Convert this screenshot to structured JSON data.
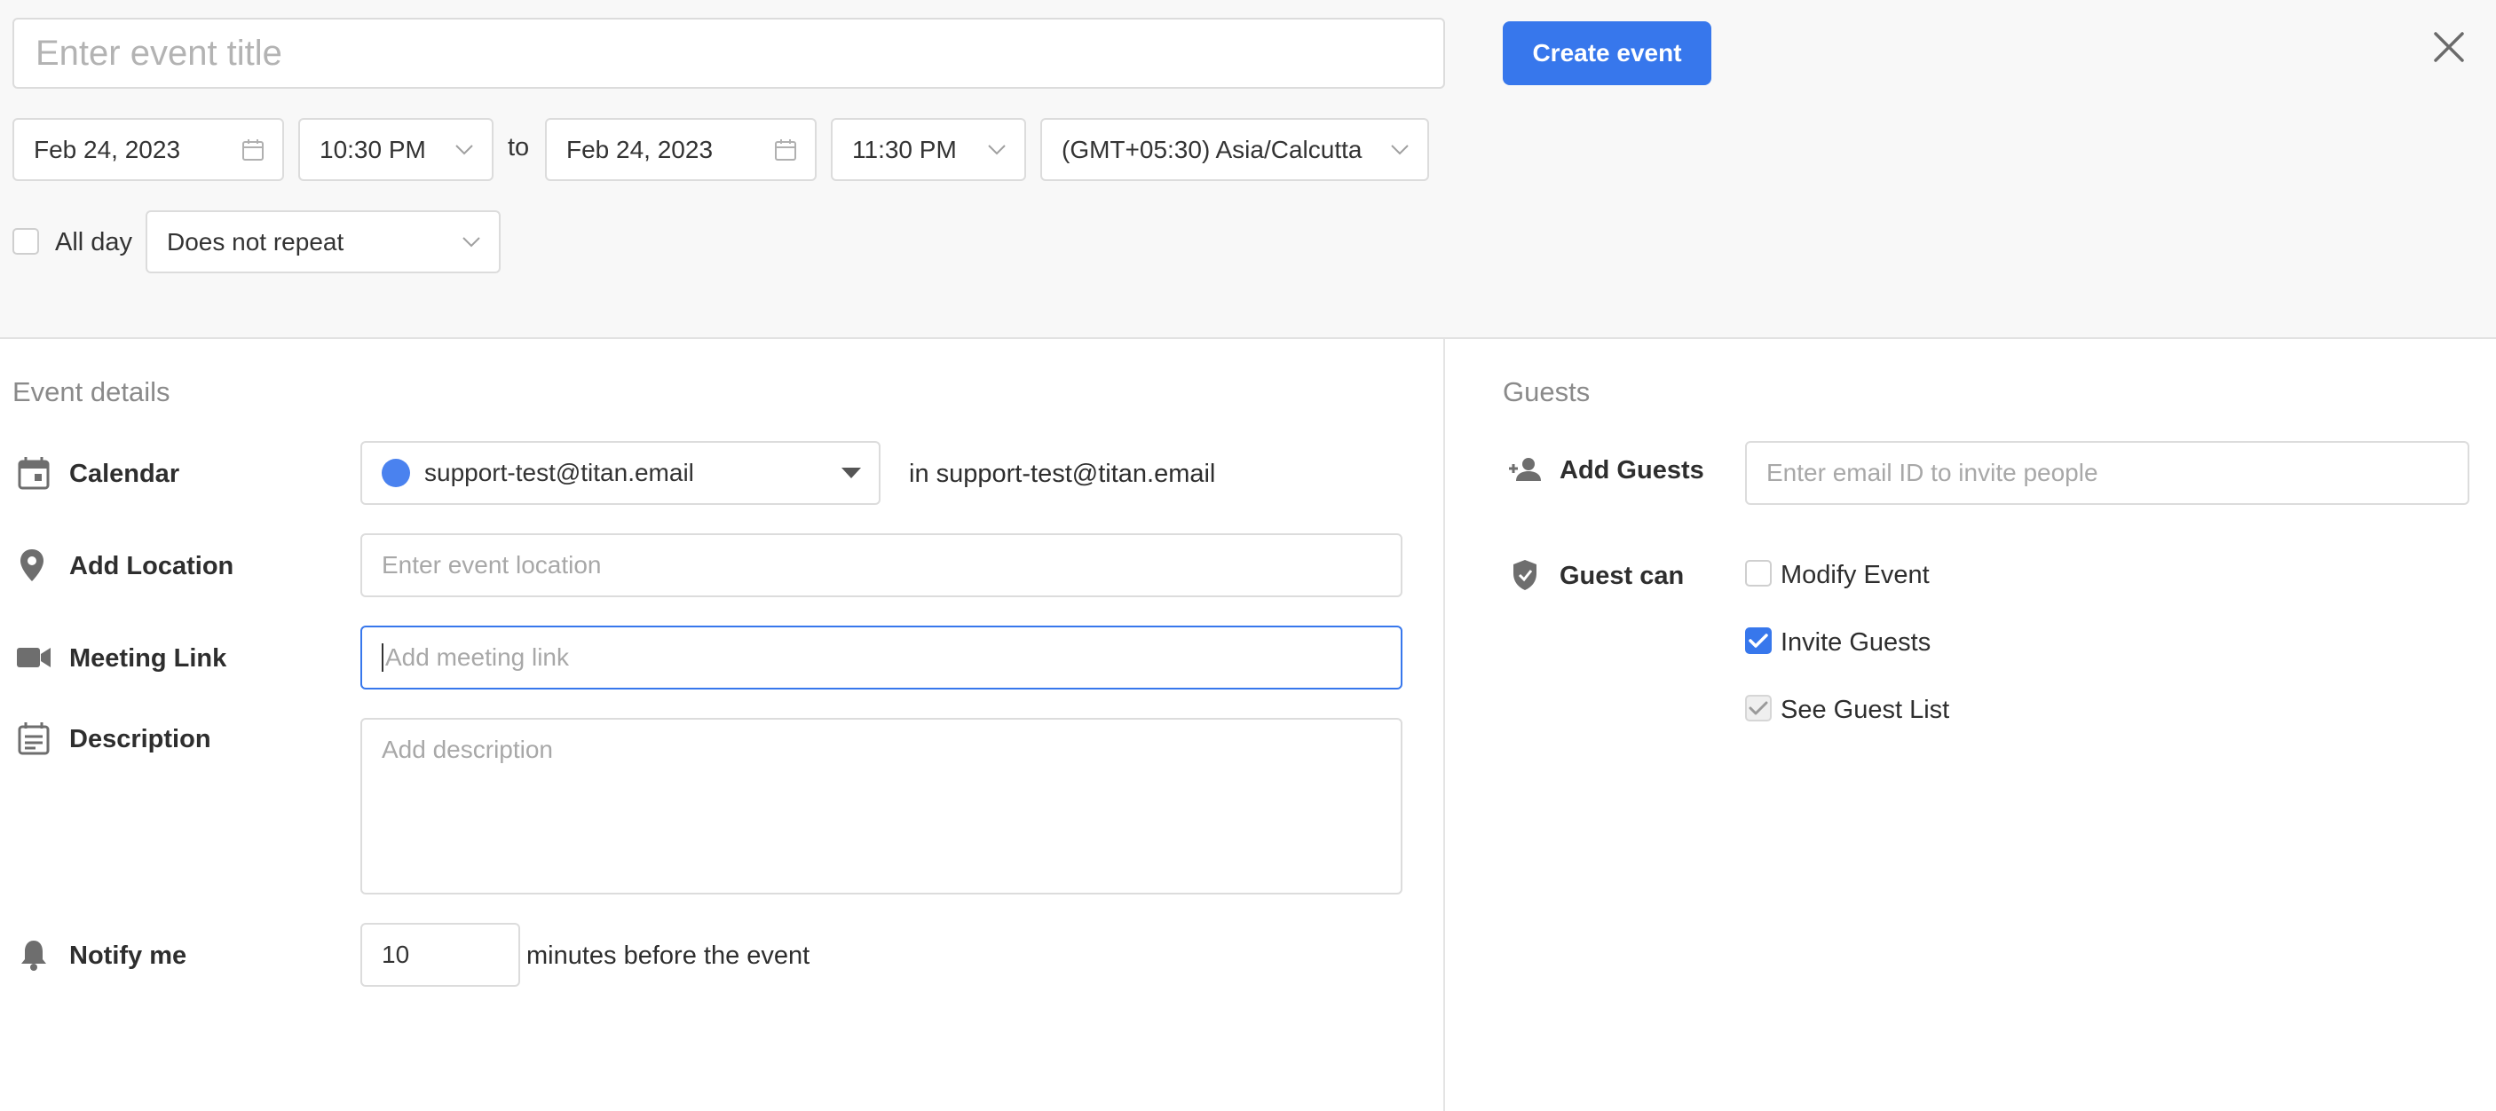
{
  "header": {
    "title_placeholder": "Enter event title",
    "create_label": "Create event"
  },
  "datetime": {
    "start_date": "Feb 24, 2023",
    "start_time": "10:30 PM",
    "to_label": "to",
    "end_date": "Feb 24, 2023",
    "end_time": "11:30 PM",
    "timezone": "(GMT+05:30) Asia/Calcutta",
    "all_day_label": "All day",
    "all_day_checked": false,
    "repeat": "Does not repeat"
  },
  "details": {
    "section_title": "Event details",
    "calendar_label": "Calendar",
    "calendar_value": "support-test@titan.email",
    "calendar_color": "#4a82ef",
    "calendar_in_text": "in support-test@titan.email",
    "location_label": "Add Location",
    "location_placeholder": "Enter event location",
    "meeting_label": "Meeting Link",
    "meeting_placeholder": "Add meeting link",
    "description_label": "Description",
    "description_placeholder": "Add description",
    "notify_label": "Notify me",
    "notify_value": "10",
    "notify_suffix": "minutes before the event"
  },
  "guests": {
    "section_title": "Guests",
    "add_label": "Add Guests",
    "add_placeholder": "Enter email ID to invite people",
    "can_label": "Guest can",
    "permissions": [
      {
        "label": "Modify Event",
        "checked": false
      },
      {
        "label": "Invite Guests",
        "checked": true
      },
      {
        "label": "See Guest List",
        "checked": true,
        "disabled": true
      }
    ]
  },
  "colors": {
    "accent": "#3777ec",
    "background_top": "#f8f8f8"
  }
}
